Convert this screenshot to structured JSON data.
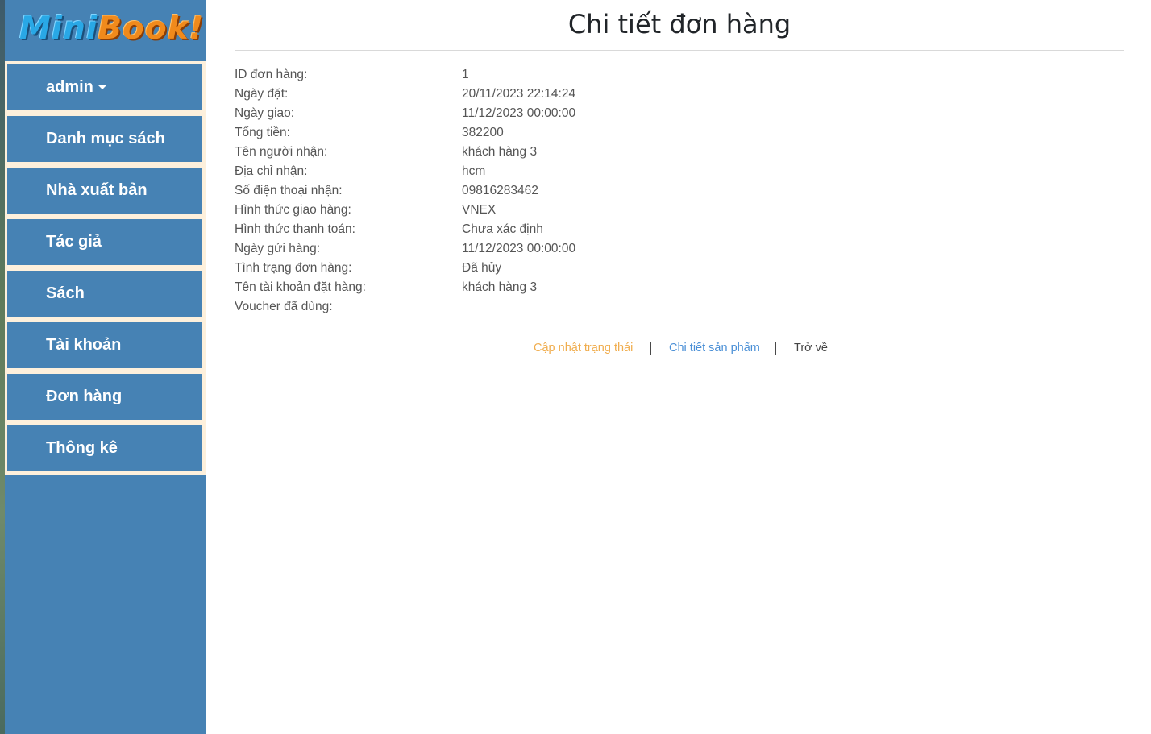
{
  "logo": {
    "part1": "Mini",
    "part2": "Book!"
  },
  "sidebar": {
    "items": [
      {
        "label": "admin"
      },
      {
        "label": "Danh mục sách"
      },
      {
        "label": "Nhà xuất bản"
      },
      {
        "label": "Tác giả"
      },
      {
        "label": "Sách"
      },
      {
        "label": "Tài khoản"
      },
      {
        "label": "Đơn hàng"
      },
      {
        "label": "Thông kê"
      }
    ]
  },
  "main": {
    "title": "Chi tiết đơn hàng",
    "details": [
      {
        "label": "ID đơn hàng:",
        "value": "1"
      },
      {
        "label": "Ngày đặt:",
        "value": "20/11/2023 22:14:24"
      },
      {
        "label": "Ngày giao:",
        "value": "11/12/2023 00:00:00"
      },
      {
        "label": "Tổng tiền:",
        "value": "382200"
      },
      {
        "label": "Tên người nhận:",
        "value": "khách hàng 3"
      },
      {
        "label": "Địa chỉ nhận:",
        "value": "hcm"
      },
      {
        "label": "Số điện thoại nhận:",
        "value": "09816283462"
      },
      {
        "label": "Hình thức giao hàng:",
        "value": "VNEX"
      },
      {
        "label": "Hình thức thanh toán:",
        "value": "Chưa xác định"
      },
      {
        "label": "Ngày gửi hàng:",
        "value": "11/12/2023 00:00:00"
      },
      {
        "label": "Tình trạng đơn hàng:",
        "value": "Đã hủy"
      },
      {
        "label": "Tên tài khoản đặt hàng:",
        "value": "khách hàng 3"
      },
      {
        "label": "Voucher đã dùng:",
        "value": ""
      }
    ],
    "actions": {
      "update_status": "Cập nhật trạng thái",
      "product_details": "Chi tiết sản phẩm",
      "back": "Trở về",
      "separator": "|"
    }
  },
  "colors": {
    "sidebar_bg": "#4682b4",
    "menu_frame": "#fdf0dc",
    "update_link": "#f0ad4e",
    "detail_link": "#4a8fd6"
  }
}
